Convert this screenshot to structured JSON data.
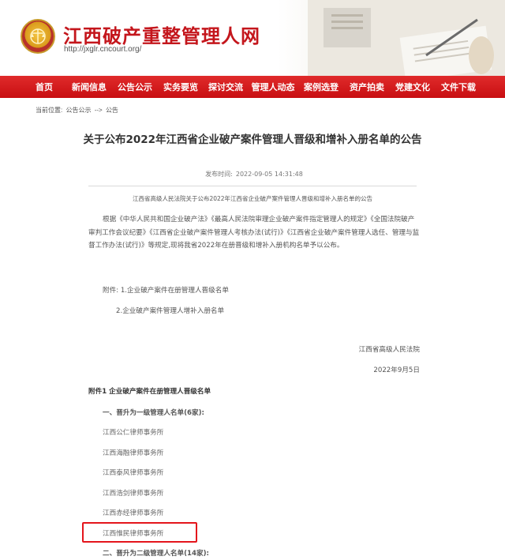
{
  "site": {
    "title": "江西破产重整管理人网",
    "url": "http://jxglr.cncourt.org/"
  },
  "nav": [
    "首页",
    "新闻信息",
    "公告公示",
    "实务要览",
    "探讨交流",
    "管理人动态",
    "案例选登",
    "资产拍卖",
    "党建文化",
    "文件下载"
  ],
  "breadcrumb": {
    "label": "当前位置:",
    "items": [
      "公告公示",
      "-->",
      "公告"
    ]
  },
  "article": {
    "title": "关于公布2022年江西省企业破产案件管理人晋级和增补入册名单的公告",
    "pubtime_label": "发布时间:",
    "pubtime": "2022-09-05 14:31:48",
    "summary": "江西省高级人民法院关于公布2022年江西省企业破产案件管理人晋级和增补入册名单的公告",
    "paragraph": "根据《中华人民共和国企业破产法》《最高人民法院审理企业破产案件指定管理人的规定》《全国法院破产审判工作会议纪要》《江西省企业破产案件管理人考核办法(试行)》《江西省企业破产案件管理人选任、管理与监督工作办法(试行)》等规定,现将我省2022年在册晋级和增补入册机构名单予以公布。",
    "attachment1": "附件: 1.企业破产案件在册管理人晋级名单",
    "attachment2": "2.企业破产案件管理人增补入册名单",
    "signer": "江西省高级人民法院",
    "date": "2022年9月5日",
    "section_head": "附件1  企业破产案件在册管理人晋级名单",
    "sub1": "一、晋升为一级管理人名单(6家):",
    "firms": [
      "江西公仁律师事务所",
      "江西海融律师事务所",
      "江西泰风律师事务所",
      "江西浩剑律师事务所",
      "江西赤经律师事务所",
      "江西惟民律师事务所"
    ],
    "sub2": "二、晋升为二级管理人名单(14家):"
  },
  "colors": {
    "brand_red": "#c4161c",
    "nav_red": "#d41a1c",
    "highlight_border": "#e4151c"
  }
}
